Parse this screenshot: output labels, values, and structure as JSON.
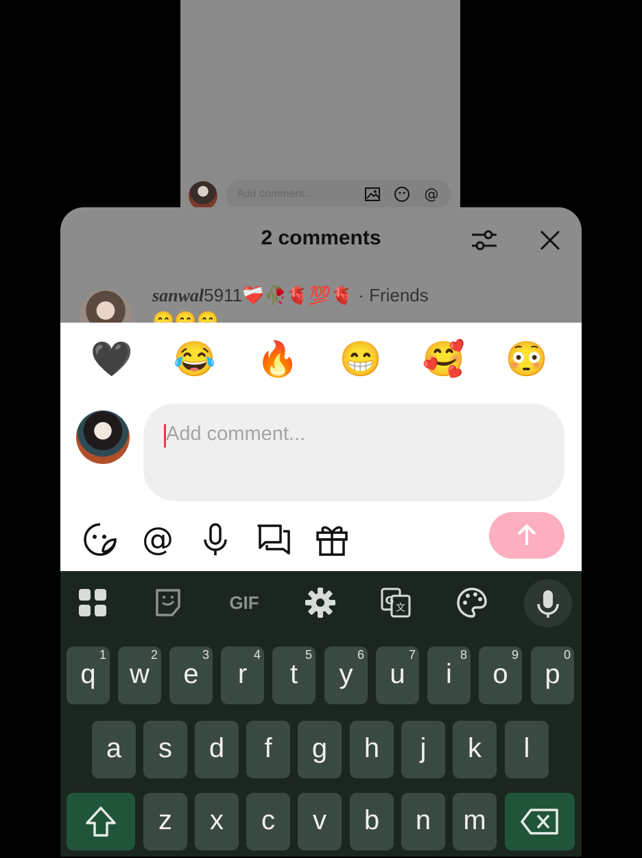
{
  "background": {
    "comment_bar": {
      "placeholder": "Add comment..."
    }
  },
  "sheet": {
    "title": "2 comments",
    "first_comment": {
      "username": "sanwal5911",
      "username_styled": "sanwal",
      "username_suffix": "5911",
      "decor": "❤️‍🩹🥀🫀💯🫀",
      "relation": "· Friends",
      "text": "😁😁😁"
    }
  },
  "reply_panel": {
    "quick_emojis": [
      "🖤",
      "😂",
      "🔥",
      "😁",
      "🥰",
      "😳"
    ],
    "input": {
      "placeholder": "Add comment..."
    },
    "tools": [
      "sticker-icon",
      "mention-icon",
      "microphone-icon",
      "chat-icon",
      "gift-icon"
    ],
    "send_color": "#fcafc0"
  },
  "keyboard": {
    "toolbar": {
      "gif_label": "GIF"
    },
    "rows": [
      [
        {
          "k": "q",
          "h": "1"
        },
        {
          "k": "w",
          "h": "2"
        },
        {
          "k": "e",
          "h": "3"
        },
        {
          "k": "r",
          "h": "4"
        },
        {
          "k": "t",
          "h": "5"
        },
        {
          "k": "y",
          "h": "6"
        },
        {
          "k": "u",
          "h": "7"
        },
        {
          "k": "i",
          "h": "8"
        },
        {
          "k": "o",
          "h": "9"
        },
        {
          "k": "p",
          "h": "0"
        }
      ],
      [
        {
          "k": "a"
        },
        {
          "k": "s"
        },
        {
          "k": "d"
        },
        {
          "k": "f"
        },
        {
          "k": "g"
        },
        {
          "k": "h"
        },
        {
          "k": "j"
        },
        {
          "k": "k"
        },
        {
          "k": "l"
        }
      ],
      [
        {
          "k": "z"
        },
        {
          "k": "x"
        },
        {
          "k": "c"
        },
        {
          "k": "v"
        },
        {
          "k": "b"
        },
        {
          "k": "n"
        },
        {
          "k": "m"
        }
      ]
    ]
  }
}
